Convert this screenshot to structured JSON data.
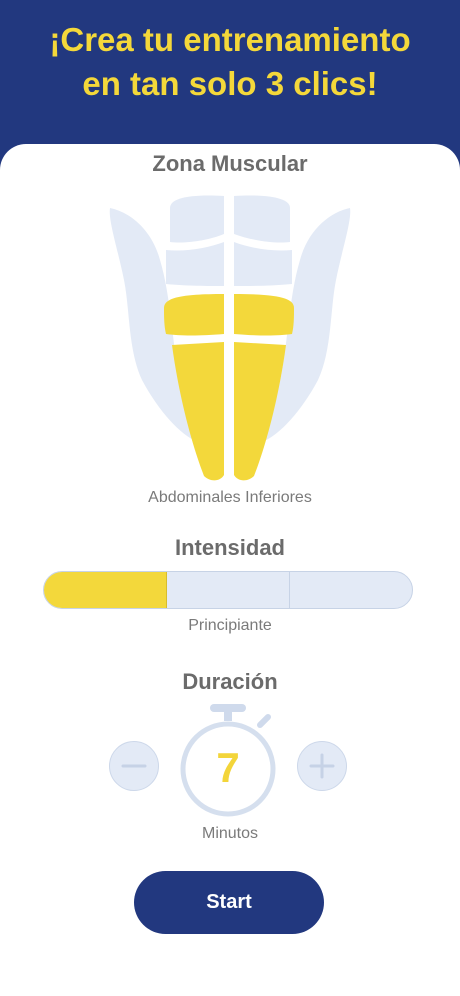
{
  "header": {
    "line1": "¡Crea tu entrenamiento",
    "line2": "en tan solo 3 clics!"
  },
  "muscle_zone": {
    "title": "Zona Muscular",
    "selected_label": "Abdominales Inferiores"
  },
  "intensity": {
    "title": "Intensidad",
    "level_label": "Principiante",
    "levels_total": 3,
    "levels_selected": 1
  },
  "duration": {
    "title": "Duración",
    "value": "7",
    "unit_label": "Minutos",
    "decrement_icon": "minus-icon",
    "increment_icon": "plus-icon"
  },
  "start_button": {
    "label": "Start"
  },
  "colors": {
    "brand_blue": "#22387f",
    "accent_yellow": "#f3d83b",
    "muted_blue": "#e3eaf6",
    "text_gray": "#6b6b6b"
  }
}
